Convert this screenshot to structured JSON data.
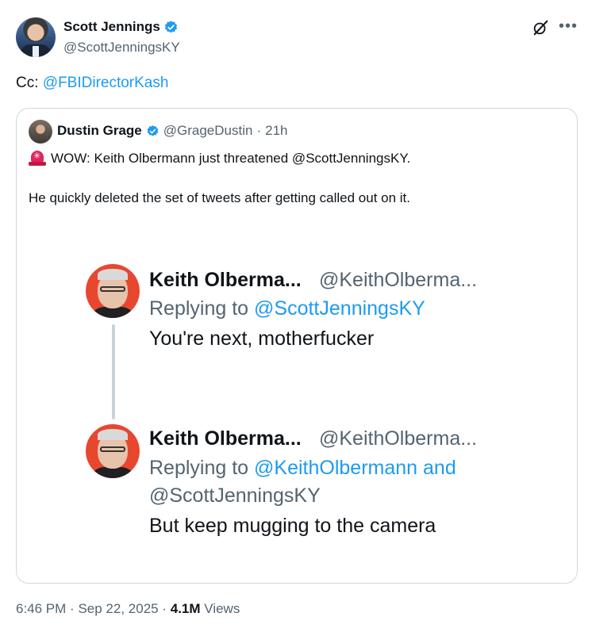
{
  "author": {
    "name": "Scott Jennings",
    "handle": "@ScottJenningsKY"
  },
  "tweet": {
    "prefix": "Cc: ",
    "mention": "@FBIDirectorKash"
  },
  "icons": {
    "verified": "verified-badge-icon",
    "grok": "grok-icon",
    "more": "more-icon",
    "siren": "siren-icon"
  },
  "colors": {
    "accent": "#1d9bf0",
    "secondary_text": "#536471",
    "border": "#cfd9de"
  },
  "quote": {
    "name": "Dustin Grage",
    "handle": "@GrageDustin",
    "separator": "·",
    "time": "21h",
    "line1": "WOW: Keith Olbermann just threatened @ScottJenningsKY.",
    "line2": "He quickly deleted the set of tweets after getting called out on it.",
    "screenshot": {
      "first": {
        "name": "Keith Olberma...",
        "handle": "@KeithOlberma...",
        "replying_prefix": "Replying to ",
        "replying_to": "@ScottJenningsKY",
        "text": "You're next, motherfucker"
      },
      "second": {
        "name": "Keith Olberma...",
        "handle": "@KeithOlberma...",
        "replying_prefix": "Replying to ",
        "replying_to_line1": "@KeithOlbermann and",
        "replying_to_line2": "@ScottJenningsKY",
        "text": "But keep mugging to the camera"
      }
    }
  },
  "meta": {
    "time": "6:46 PM",
    "sep1": "·",
    "date": "Sep 22, 2025",
    "sep2": "·",
    "views_count": "4.1M",
    "views_label": "Views"
  }
}
